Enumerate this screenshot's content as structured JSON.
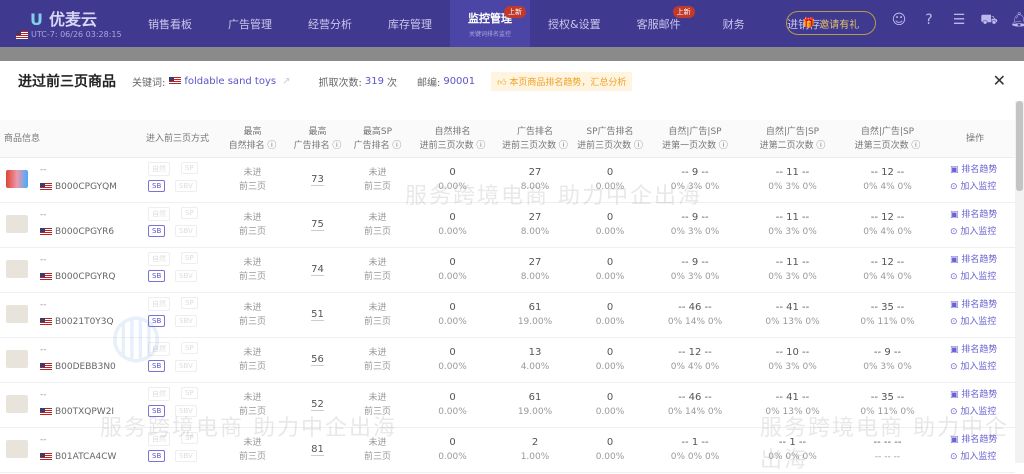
{
  "app": {
    "name": "优麦云",
    "clock": "UTC-7: 06/26 03:28:15"
  },
  "nav": [
    {
      "label": "销售看板"
    },
    {
      "label": "广告管理"
    },
    {
      "label": "经营分析"
    },
    {
      "label": "库存管理"
    },
    {
      "label": "监控管理",
      "sub": "关键词排名监控",
      "badge": "上新",
      "active": true
    },
    {
      "label": "授权&设置"
    },
    {
      "label": "客服邮件",
      "badge": "上新"
    },
    {
      "label": "财务"
    },
    {
      "label": "进销存"
    }
  ],
  "header": {
    "invite": "邀请有礼"
  },
  "modal": {
    "title": "进过前三页商品",
    "keyword_label": "关键词:",
    "keyword": "foldable sand toys",
    "fetch_label": "抓取次数:",
    "fetch_count": "319",
    "fetch_unit": "次",
    "zip_label": "邮编:",
    "zip": "90001",
    "tip": "本页商品排名趋势，汇总分析"
  },
  "columns": [
    [
      "商品信息"
    ],
    [
      "进入前三页方式"
    ],
    [
      "最高",
      "自然排名 ⓘ"
    ],
    [
      "最高",
      "广告排名 ⓘ"
    ],
    [
      "最高SP",
      "广告排名 ⓘ"
    ],
    [
      "自然排名",
      "进前三页次数 ⓘ"
    ],
    [
      "广告排名",
      "进前三页次数 ⓘ"
    ],
    [
      "SP广告排名",
      "进前三页次数 ⓘ"
    ],
    [
      "自然|广告|SP",
      "进第一页次数 ⓘ"
    ],
    [
      "自然|广告|SP",
      "进第二页次数 ⓘ"
    ],
    [
      "自然|广告|SP",
      "进第三页次数 ⓘ"
    ],
    [
      "操作"
    ]
  ],
  "tags": [
    "自然",
    "SP",
    "SB",
    "SBV"
  ],
  "not_in": [
    "未进",
    "前三页"
  ],
  "actions": [
    "排名趋势",
    "加入监控"
  ],
  "rows": [
    {
      "asin": "B000CPGYQM",
      "title": "--",
      "ad_best": "73",
      "nat": [
        "0",
        "0.00%"
      ],
      "ad": [
        "27",
        "8.00%"
      ],
      "sp": [
        "0",
        "0.00%"
      ],
      "p1": [
        "-- 9 --",
        "0% 3% 0%"
      ],
      "p2": [
        "-- 11 --",
        "0% 3% 0%"
      ],
      "p3": [
        "-- 12 --",
        "0% 4% 0%"
      ]
    },
    {
      "asin": "B000CPGYR6",
      "title": "--",
      "ad_best": "75",
      "nat": [
        "0",
        "0.00%"
      ],
      "ad": [
        "27",
        "8.00%"
      ],
      "sp": [
        "0",
        "0.00%"
      ],
      "p1": [
        "-- 9 --",
        "0% 3% 0%"
      ],
      "p2": [
        "-- 11 --",
        "0% 3% 0%"
      ],
      "p3": [
        "-- 12 --",
        "0% 4% 0%"
      ]
    },
    {
      "asin": "B000CPGYRQ",
      "title": "--",
      "ad_best": "74",
      "nat": [
        "0",
        "0.00%"
      ],
      "ad": [
        "27",
        "8.00%"
      ],
      "sp": [
        "0",
        "0.00%"
      ],
      "p1": [
        "-- 9 --",
        "0% 3% 0%"
      ],
      "p2": [
        "-- 11 --",
        "0% 3% 0%"
      ],
      "p3": [
        "-- 12 --",
        "0% 4% 0%"
      ]
    },
    {
      "asin": "B0021T0Y3Q",
      "title": "--",
      "ad_best": "51",
      "nat": [
        "0",
        "0.00%"
      ],
      "ad": [
        "61",
        "19.00%"
      ],
      "sp": [
        "0",
        "0.00%"
      ],
      "p1": [
        "-- 46 --",
        "0% 14% 0%"
      ],
      "p2": [
        "-- 41 --",
        "0% 13% 0%"
      ],
      "p3": [
        "-- 35 --",
        "0% 11% 0%"
      ]
    },
    {
      "asin": "B00DEBB3N0",
      "title": "--",
      "ad_best": "56",
      "nat": [
        "0",
        "0.00%"
      ],
      "ad": [
        "13",
        "4.00%"
      ],
      "sp": [
        "0",
        "0.00%"
      ],
      "p1": [
        "-- 12 --",
        "0% 4% 0%"
      ],
      "p2": [
        "-- 10 --",
        "0% 3% 0%"
      ],
      "p3": [
        "-- 9 --",
        "0% 3% 0%"
      ]
    },
    {
      "asin": "B00TXQPW2I",
      "title": "--",
      "ad_best": "52",
      "nat": [
        "0",
        "0.00%"
      ],
      "ad": [
        "61",
        "19.00%"
      ],
      "sp": [
        "0",
        "0.00%"
      ],
      "p1": [
        "-- 46 --",
        "0% 14% 0%"
      ],
      "p2": [
        "-- 41 --",
        "0% 13% 0%"
      ],
      "p3": [
        "-- 35 --",
        "0% 11% 0%"
      ]
    },
    {
      "asin": "B01ATCA4CW",
      "title": "--",
      "ad_best": "81",
      "nat": [
        "0",
        "0.00%"
      ],
      "ad": [
        "2",
        "1.00%"
      ],
      "sp": [
        "0",
        "0.00%"
      ],
      "p1": [
        "-- 1 --",
        "0% 0% 0%"
      ],
      "p2": [
        "-- 1 --",
        "0% 0% 0%"
      ],
      "p3": [
        "-- -- --",
        "-- -- --"
      ]
    }
  ],
  "watermark": {
    "text": "服务跨境电商 助力中企出海",
    "logo": "王树跨境"
  }
}
